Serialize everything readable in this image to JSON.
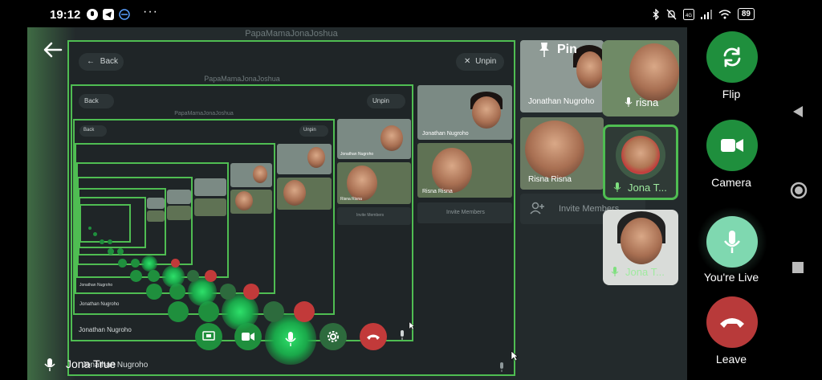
{
  "status_bar": {
    "time": "19:12",
    "battery": "89",
    "more": "···",
    "icons_left": [
      "mic-indicator-icon",
      "telegram-icon",
      "vpn-icon"
    ],
    "icons_right": [
      "bluetooth-icon",
      "mute-bell-icon",
      "volte-icon",
      "signal-icon",
      "wifi-icon",
      "battery-icon"
    ]
  },
  "shared_screen": {
    "window_title": "PapaMamaJonaJoshua",
    "back_label": "Back",
    "unpin_label": "Unpin",
    "bottom_name": "Jonathan Nugroho",
    "inner_name": "Jonathan Nugroho",
    "invite_label": "Invite Members",
    "inner_labels": {
      "jonathan": "Jonathan Nugroho",
      "risna": "Risna Risna"
    }
  },
  "participants_panel": {
    "pin_label": "Pin",
    "jonathan_label": "Jonathan Nugroho",
    "risna_label": "Risna Risna",
    "invite_label": "Invite Members"
  },
  "floating_tiles": {
    "risna_label": "risna",
    "jona_selected_label": "Jona T...",
    "jona_video_label": "Jona T..."
  },
  "self_label": "Jona True",
  "right_controls": {
    "flip_label": "Flip",
    "camera_label": "Camera",
    "live_label": "You're Live",
    "leave_label": "Leave"
  },
  "colors": {
    "accent_green": "#4fbd52",
    "button_green": "#1f8f3d",
    "leave_red": "#b83a3a",
    "live_teal": "#7fd8b0",
    "background": "#232a2c"
  }
}
